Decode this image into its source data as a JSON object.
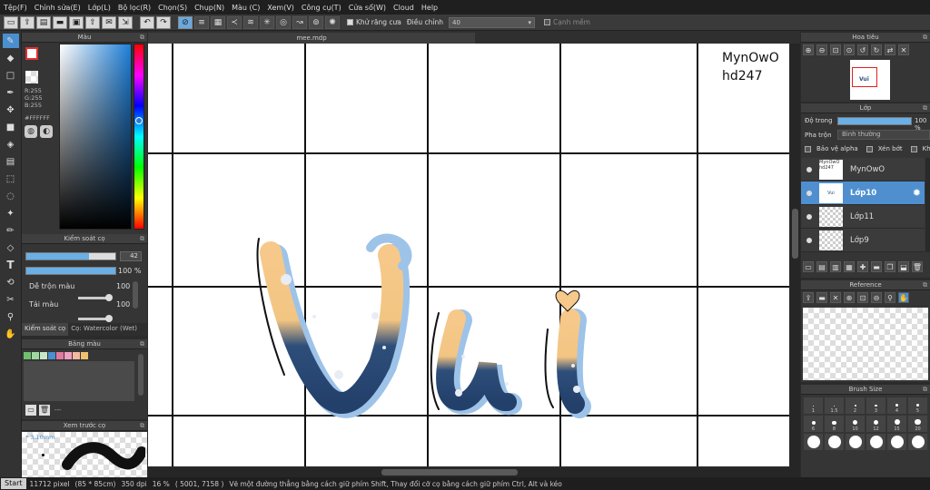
{
  "menu": [
    "Tệp(F)",
    "Chỉnh sửa(E)",
    "Lớp(L)",
    "Bộ lọc(R)",
    "Chọn(S)",
    "Chụp(N)",
    "Màu (C)",
    "Xem(V)",
    "Công cụ(T)",
    "Cửa sổ(W)",
    "Cloud",
    "Help"
  ],
  "toolbar": {
    "antialias_label": "Khử răng cưa",
    "adjust_label": "Điều chỉnh",
    "adjust_value": "40",
    "edge_label": "Cạnh mềm"
  },
  "color_panel": {
    "title": "Màu",
    "r": "R:255",
    "g": "G:255",
    "b": "B:255",
    "hex": "#FFFFFF",
    "primary_color": "#ffffff",
    "accent": "#1e7fd8"
  },
  "brush_control": {
    "title": "Kiểm soát cọ",
    "size_value": "42",
    "size_fill": 0.7,
    "opacity_value": "100 %",
    "opacity_fill": 1.0,
    "blend_label": "Dễ trộn màu",
    "blend_value": "100",
    "reload_label": "Tải màu",
    "reload_value": "100",
    "tab1": "Kiểm soát cọ",
    "tab2": "Cọ: Watercolor (Wet)"
  },
  "swatch_panel": {
    "title": "Bảng màu",
    "more": "---",
    "colors": [
      "#6fbf6f",
      "#9fd89f",
      "#c8e8c8",
      "#4a8fcf",
      "#e07aa0",
      "#f0a0c0",
      "#f4b8a0",
      "#f0c070"
    ]
  },
  "brush_preview": {
    "title": "Xem trước cọ",
    "size": "* 3.10mm"
  },
  "document": {
    "tab_name": "mee.mdp",
    "author_line1": "MynOwO",
    "author_line2": "hd247"
  },
  "navigator": {
    "title": "Hoa tiêu"
  },
  "layers": {
    "title": "Lớp",
    "opacity_label": "Độ trong",
    "opacity_value": "100 %",
    "blend_label": "Pha trộn",
    "blend_value": "Bình thường",
    "protect_alpha": "Bảo vệ alpha",
    "clip": "Xén bớt",
    "lock": "Khóa",
    "items": [
      {
        "name": "MynOwO",
        "thumb": "MynOwO hd247"
      },
      {
        "name": "Lớp10",
        "thumb": "Vui"
      },
      {
        "name": "Lớp11",
        "thumb": ""
      },
      {
        "name": "Lớp9",
        "thumb": ""
      }
    ]
  },
  "reference": {
    "title": "Reference"
  },
  "brush_size": {
    "title": "Brush Size",
    "labels": [
      "1",
      "1.5",
      "2",
      "3",
      "4",
      "5",
      "6",
      "8",
      "10",
      "12",
      "15",
      "20"
    ]
  },
  "status": {
    "start": "Start",
    "pixel": "11712 pixel",
    "physical": "(85 * 85cm)",
    "dpi": "350 dpi",
    "zoom": "16 %",
    "coords": "( 5001, 7158 )",
    "hint": "Vẽ một đường thẳng bằng cách giữ phím Shift, Thay đổi cỡ cọ bằng cách giữ phím Ctrl, Alt và kéo"
  }
}
